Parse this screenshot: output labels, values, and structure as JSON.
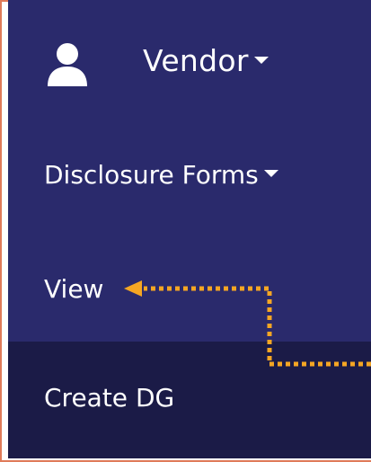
{
  "nav": {
    "user_label": "Vendor",
    "forms_label": "Disclosure Forms",
    "view_label": "View",
    "create_label": "Create DG"
  },
  "icons": {
    "user": "user-icon",
    "caret": "caret-down-icon"
  },
  "colors": {
    "nav_background": "#2a2a6c",
    "selected_row": "#1b1b47",
    "annotation_arrow": "#f5a623",
    "frame_border": "#e07b5a"
  }
}
